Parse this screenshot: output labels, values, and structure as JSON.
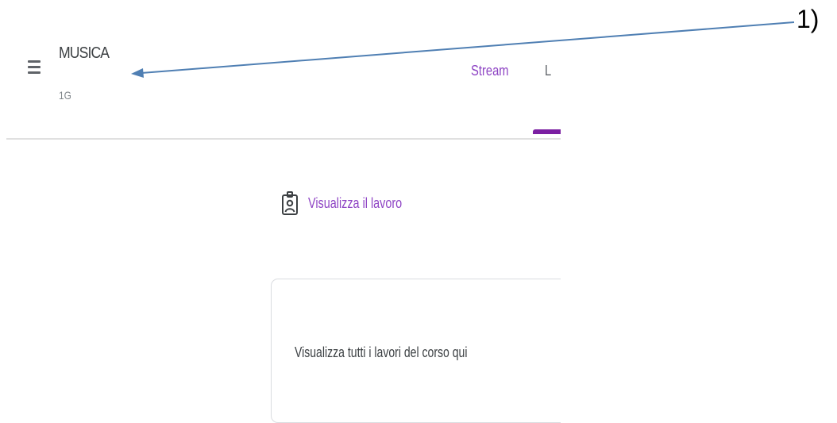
{
  "course": {
    "title": "MUSICA",
    "section": "1G"
  },
  "tabs": [
    {
      "label": "Stream"
    },
    {
      "label": "L"
    }
  ],
  "view_work": {
    "label": "Visualizza il lavoro",
    "icon": "assignment-ind-icon"
  },
  "card": {
    "text": "Visualizza tutti i lavori del corso qui"
  },
  "annotation": {
    "label": "1)"
  },
  "colors": {
    "accent": "#8e44c4",
    "tab_indicator": "#7b1fa2",
    "arrow": "#4f7fb3"
  }
}
